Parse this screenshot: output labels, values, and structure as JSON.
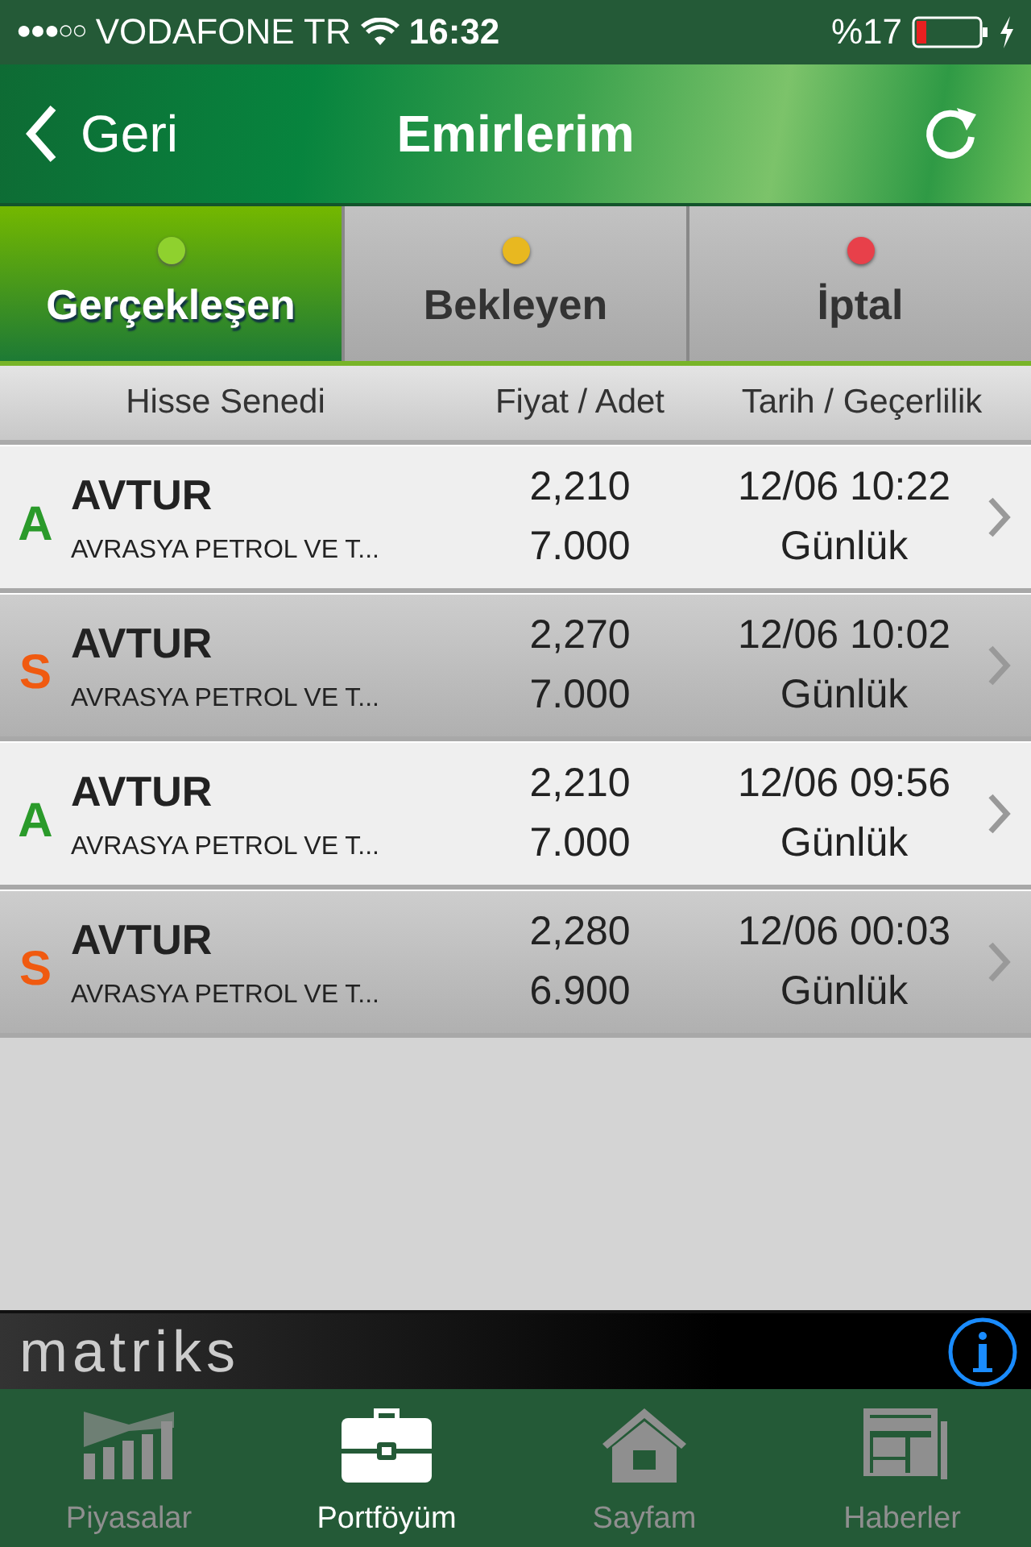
{
  "status_bar": {
    "signal": "●●●○○",
    "carrier": "VODAFONE TR",
    "time": "16:32",
    "battery_text": "%17"
  },
  "nav": {
    "back": "Geri",
    "title": "Emirlerim"
  },
  "tabs": [
    {
      "label": "Gerçekleşen",
      "selected": true,
      "color": "#8fd12e"
    },
    {
      "label": "Bekleyen",
      "selected": false,
      "color": "#e8b820"
    },
    {
      "label": "İptal",
      "selected": false,
      "color": "#e8404a"
    }
  ],
  "columns": [
    "Hisse Senedi",
    "Fiyat / Adet",
    "Tarih / Geçerlilik"
  ],
  "orders": [
    {
      "kind": "buy",
      "letter": "A",
      "symbol": "AVTUR",
      "name": "AVRASYA PETROL VE T...",
      "price": "2,210",
      "quantity": "7.000",
      "date": "12/06 10:22",
      "validity": "Günlük"
    },
    {
      "kind": "sell",
      "letter": "S",
      "symbol": "AVTUR",
      "name": "AVRASYA PETROL VE T...",
      "price": "2,270",
      "quantity": "7.000",
      "date": "12/06 10:02",
      "validity": "Günlük"
    },
    {
      "kind": "buy",
      "letter": "A",
      "symbol": "AVTUR",
      "name": "AVRASYA PETROL VE T...",
      "price": "2,210",
      "quantity": "7.000",
      "date": "12/06 09:56",
      "validity": "Günlük"
    },
    {
      "kind": "sell",
      "letter": "S",
      "symbol": "AVTUR",
      "name": "AVRASYA PETROL VE T...",
      "price": "2,280",
      "quantity": "6.900",
      "date": "12/06 00:03",
      "validity": "Günlük"
    }
  ],
  "brand": "matriks",
  "tab_bar": [
    {
      "label": "Piyasalar",
      "selected": false
    },
    {
      "label": "Portföyüm",
      "selected": true
    },
    {
      "label": "Sayfam",
      "selected": false
    },
    {
      "label": "Haberler",
      "selected": false
    }
  ]
}
